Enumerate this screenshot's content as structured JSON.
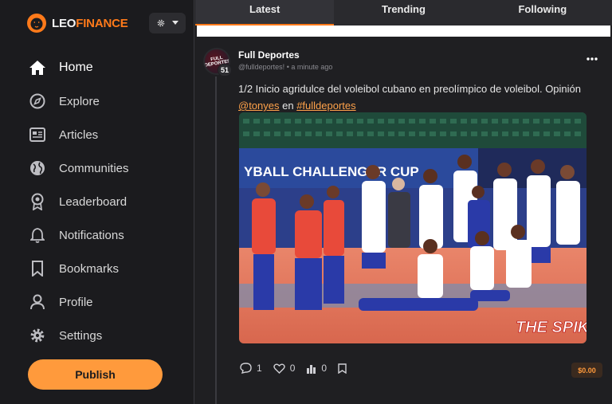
{
  "brand": {
    "part1": "LEO",
    "part2": "FINANCE",
    "accent": "#ff7a1a"
  },
  "sidebar": {
    "items": [
      {
        "label": "Home",
        "icon": "home-icon",
        "active": true
      },
      {
        "label": "Explore",
        "icon": "compass-icon"
      },
      {
        "label": "Articles",
        "icon": "articles-icon"
      },
      {
        "label": "Communities",
        "icon": "globe-icon"
      },
      {
        "label": "Leaderboard",
        "icon": "award-icon"
      },
      {
        "label": "Notifications",
        "icon": "bell-icon"
      },
      {
        "label": "Bookmarks",
        "icon": "bookmark-icon"
      },
      {
        "label": "Profile",
        "icon": "user-icon"
      },
      {
        "label": "Settings",
        "icon": "gear-icon"
      }
    ],
    "publish_label": "Publish"
  },
  "tabs": [
    {
      "label": "Latest",
      "active": true
    },
    {
      "label": "Trending"
    },
    {
      "label": "Following"
    }
  ],
  "post": {
    "author": "Full Deportes",
    "handle": "@fulldeportes!",
    "sep": "•",
    "time": "a minute ago",
    "reputation": "51",
    "text_start": "1/2 Inicio agridulce del voleibol cubano en preolímpico de voleibol. Opinión ",
    "mention": "@tonyes",
    "text_mid": " en ",
    "hashtag": "#fulldeportes",
    "image_banner": "YBALL CHALLENGER CUP",
    "image_watermark": "THE SPIKE",
    "comments": "1",
    "likes": "0",
    "stats": "0",
    "payout": "$0.00"
  }
}
